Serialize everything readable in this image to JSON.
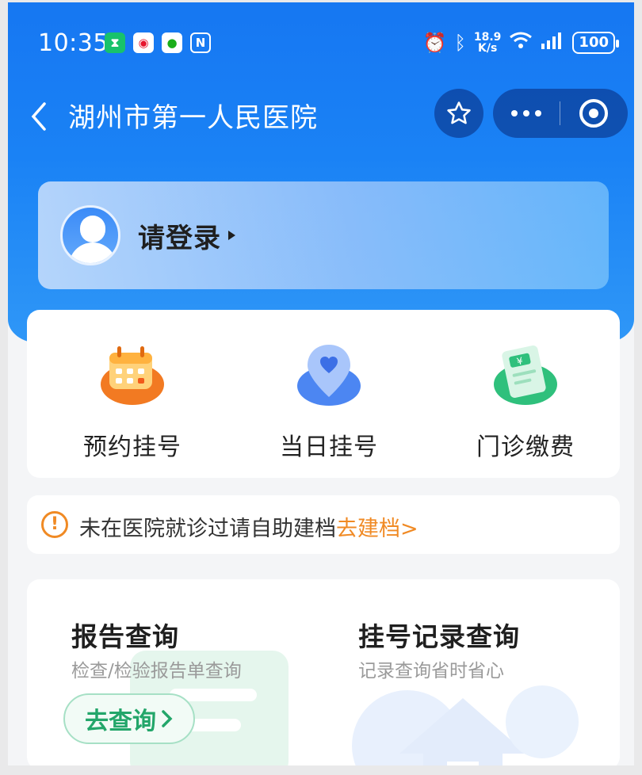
{
  "status_bar": {
    "time": "10:35",
    "net_speed_value": "18.9",
    "net_speed_unit": "K/s",
    "battery": "100",
    "icons": [
      "hourglass-icon",
      "weibo-icon",
      "wechat-icon",
      "nfc-icon",
      "alarm-icon",
      "bluetooth-icon",
      "wifi-icon",
      "signal-icon",
      "battery-icon"
    ]
  },
  "nav": {
    "title": "湖州市第一人民医院",
    "back_icon": "chevron-left-icon"
  },
  "login": {
    "label": "请登录"
  },
  "menu": {
    "items": [
      {
        "label": "预约挂号",
        "icon": "calendar-icon"
      },
      {
        "label": "当日挂号",
        "icon": "location-heart-icon"
      },
      {
        "label": "门诊缴费",
        "icon": "receipt-icon"
      }
    ]
  },
  "notice": {
    "text": "未在医院就诊过请自助建档",
    "link": "去建档>"
  },
  "services": {
    "report": {
      "title": "报告查询",
      "subtitle": "检查/检验报告单查询",
      "button": "去查询"
    },
    "record": {
      "title": "挂号记录查询",
      "subtitle": "记录查询省时省心"
    }
  },
  "colors": {
    "brand_blue": "#1677f2",
    "warning_orange": "#f08a24",
    "success_green": "#23a66a"
  }
}
